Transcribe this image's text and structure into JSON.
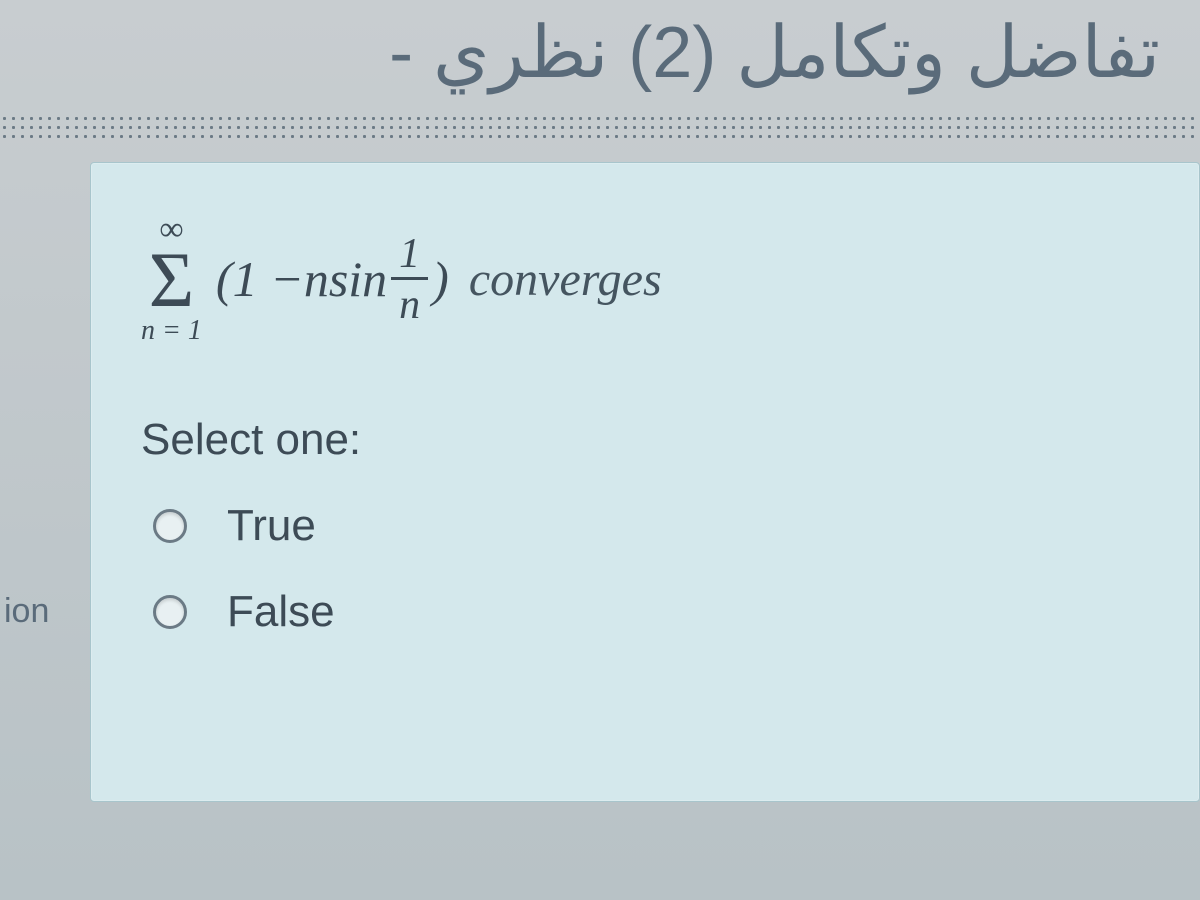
{
  "header": {
    "title_ar": "تفاضل وتكامل (2) نظري -"
  },
  "sidebar": {
    "fragment": "ion"
  },
  "question": {
    "sigma_top": "∞",
    "sigma_symbol": "Σ",
    "sigma_bottom": "n = 1",
    "open_paren": "(",
    "term1": "1 − ",
    "term2": "n",
    "term3": "sin",
    "frac_num": "1",
    "frac_den": "n",
    "close_paren": ")",
    "tail": "converges",
    "prompt": "Select one:",
    "options": [
      {
        "label": "True"
      },
      {
        "label": "False"
      }
    ]
  }
}
